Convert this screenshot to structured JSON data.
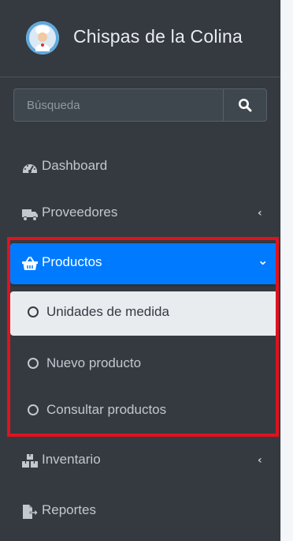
{
  "brand": {
    "name": "Chispas de la Colina",
    "logo_icon": "chef-avatar-icon"
  },
  "search": {
    "placeholder": "Búsqueda",
    "button_icon": "search-icon"
  },
  "nav": {
    "dashboard": {
      "label": "Dashboard",
      "icon": "tachometer-icon"
    },
    "proveedores": {
      "label": "Proveedores",
      "icon": "truck-icon",
      "caret": "‹"
    },
    "productos": {
      "label": "Productos",
      "icon": "shopping-basket-icon",
      "caret": "⌄",
      "children": [
        {
          "label": "Unidades de medida",
          "icon": "circle-outline-icon"
        },
        {
          "label": "Nuevo producto",
          "icon": "circle-outline-icon"
        },
        {
          "label": "Consultar productos",
          "icon": "circle-outline-icon"
        }
      ]
    },
    "inventario": {
      "label": "Inventario",
      "icon": "warehouse-icon",
      "caret": "‹"
    },
    "reportes": {
      "label": "Reportes",
      "icon": "file-export-icon"
    }
  },
  "colors": {
    "sidebar_bg": "#343a40",
    "active_bg": "#007bff",
    "sub_active_bg": "#e9ecef",
    "text": "#c2c7d0",
    "highlight": "#e0121e"
  }
}
